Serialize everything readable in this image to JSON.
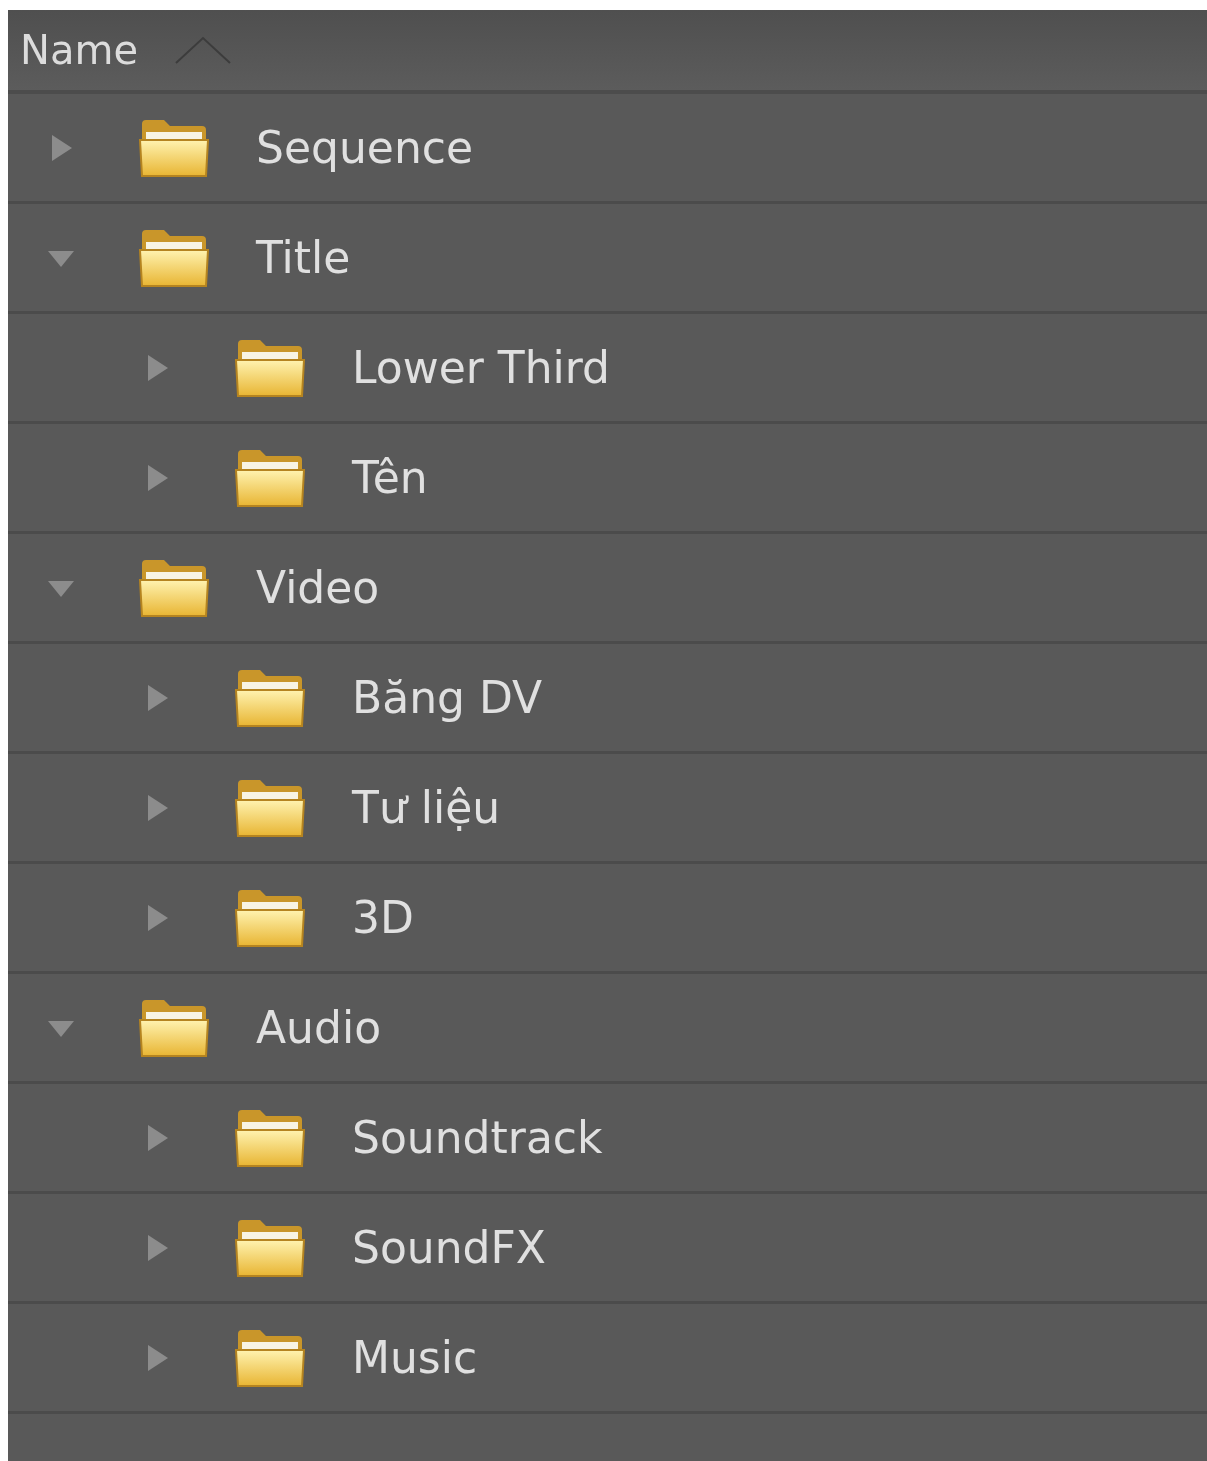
{
  "column": {
    "label": "Name",
    "sort_ascending": true
  },
  "tree": [
    {
      "name": "Sequence",
      "expanded": false
    },
    {
      "name": "Title",
      "expanded": true,
      "children": [
        {
          "name": "Lower Third",
          "expanded": false
        },
        {
          "name": "Tên",
          "expanded": false
        }
      ]
    },
    {
      "name": "Video",
      "expanded": true,
      "children": [
        {
          "name": "Băng DV",
          "expanded": false
        },
        {
          "name": "Tư liệu",
          "expanded": false
        },
        {
          "name": "3D",
          "expanded": false
        }
      ]
    },
    {
      "name": "Audio",
      "expanded": true,
      "children": [
        {
          "name": "Soundtrack",
          "expanded": false
        },
        {
          "name": "SoundFX",
          "expanded": false
        },
        {
          "name": "Music",
          "expanded": false
        }
      ]
    }
  ]
}
